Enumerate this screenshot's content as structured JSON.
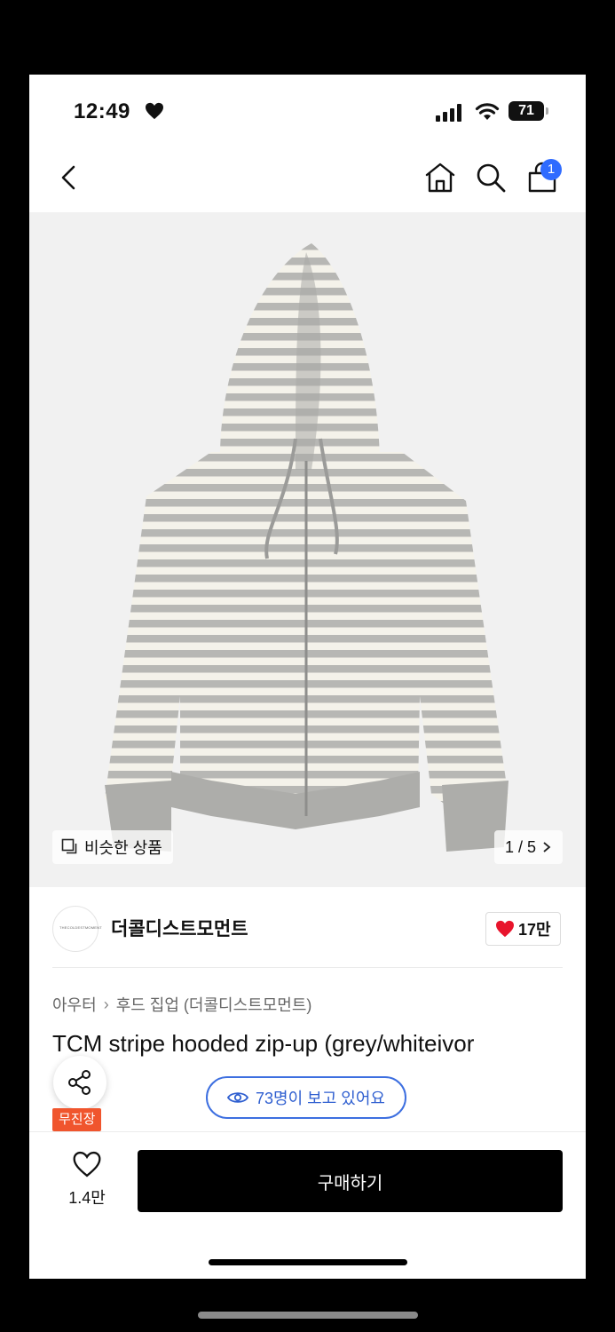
{
  "status_bar": {
    "time": "12:49",
    "battery": "71"
  },
  "header": {
    "cart_count": "1"
  },
  "product_image": {
    "similar_label": "비슷한 상품",
    "counter": "1 / 5"
  },
  "brand": {
    "name": "더콜디스트모먼트",
    "logo_text": "THECOLDESTMOMENT",
    "likes": "17만"
  },
  "breadcrumb": {
    "category": "아우터",
    "subcategory": "후드 집업 (더콜디스트모먼트)"
  },
  "product": {
    "title": "TCM stripe hooded zip-up (grey/whiteivor"
  },
  "viewers": "73명이 보고 있어요",
  "tag": "무진장",
  "bottom_bar": {
    "wish_count": "1.4만",
    "buy_label": "구매하기"
  },
  "colors": {
    "accent_blue": "#2f6bff",
    "heart_red": "#e8142c",
    "tag_orange": "#f0552d"
  }
}
